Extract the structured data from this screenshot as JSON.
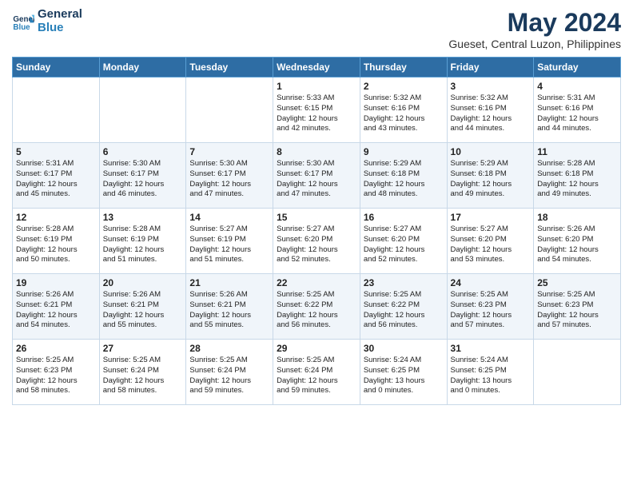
{
  "header": {
    "logo_line1": "General",
    "logo_line2": "Blue",
    "title": "May 2024",
    "subtitle": "Gueset, Central Luzon, Philippines"
  },
  "days_of_week": [
    "Sunday",
    "Monday",
    "Tuesday",
    "Wednesday",
    "Thursday",
    "Friday",
    "Saturday"
  ],
  "weeks": [
    [
      {
        "day": "",
        "info": ""
      },
      {
        "day": "",
        "info": ""
      },
      {
        "day": "",
        "info": ""
      },
      {
        "day": "1",
        "info": "Sunrise: 5:33 AM\nSunset: 6:15 PM\nDaylight: 12 hours\nand 42 minutes."
      },
      {
        "day": "2",
        "info": "Sunrise: 5:32 AM\nSunset: 6:16 PM\nDaylight: 12 hours\nand 43 minutes."
      },
      {
        "day": "3",
        "info": "Sunrise: 5:32 AM\nSunset: 6:16 PM\nDaylight: 12 hours\nand 44 minutes."
      },
      {
        "day": "4",
        "info": "Sunrise: 5:31 AM\nSunset: 6:16 PM\nDaylight: 12 hours\nand 44 minutes."
      }
    ],
    [
      {
        "day": "5",
        "info": "Sunrise: 5:31 AM\nSunset: 6:17 PM\nDaylight: 12 hours\nand 45 minutes."
      },
      {
        "day": "6",
        "info": "Sunrise: 5:30 AM\nSunset: 6:17 PM\nDaylight: 12 hours\nand 46 minutes."
      },
      {
        "day": "7",
        "info": "Sunrise: 5:30 AM\nSunset: 6:17 PM\nDaylight: 12 hours\nand 47 minutes."
      },
      {
        "day": "8",
        "info": "Sunrise: 5:30 AM\nSunset: 6:17 PM\nDaylight: 12 hours\nand 47 minutes."
      },
      {
        "day": "9",
        "info": "Sunrise: 5:29 AM\nSunset: 6:18 PM\nDaylight: 12 hours\nand 48 minutes."
      },
      {
        "day": "10",
        "info": "Sunrise: 5:29 AM\nSunset: 6:18 PM\nDaylight: 12 hours\nand 49 minutes."
      },
      {
        "day": "11",
        "info": "Sunrise: 5:28 AM\nSunset: 6:18 PM\nDaylight: 12 hours\nand 49 minutes."
      }
    ],
    [
      {
        "day": "12",
        "info": "Sunrise: 5:28 AM\nSunset: 6:19 PM\nDaylight: 12 hours\nand 50 minutes."
      },
      {
        "day": "13",
        "info": "Sunrise: 5:28 AM\nSunset: 6:19 PM\nDaylight: 12 hours\nand 51 minutes."
      },
      {
        "day": "14",
        "info": "Sunrise: 5:27 AM\nSunset: 6:19 PM\nDaylight: 12 hours\nand 51 minutes."
      },
      {
        "day": "15",
        "info": "Sunrise: 5:27 AM\nSunset: 6:20 PM\nDaylight: 12 hours\nand 52 minutes."
      },
      {
        "day": "16",
        "info": "Sunrise: 5:27 AM\nSunset: 6:20 PM\nDaylight: 12 hours\nand 52 minutes."
      },
      {
        "day": "17",
        "info": "Sunrise: 5:27 AM\nSunset: 6:20 PM\nDaylight: 12 hours\nand 53 minutes."
      },
      {
        "day": "18",
        "info": "Sunrise: 5:26 AM\nSunset: 6:20 PM\nDaylight: 12 hours\nand 54 minutes."
      }
    ],
    [
      {
        "day": "19",
        "info": "Sunrise: 5:26 AM\nSunset: 6:21 PM\nDaylight: 12 hours\nand 54 minutes."
      },
      {
        "day": "20",
        "info": "Sunrise: 5:26 AM\nSunset: 6:21 PM\nDaylight: 12 hours\nand 55 minutes."
      },
      {
        "day": "21",
        "info": "Sunrise: 5:26 AM\nSunset: 6:21 PM\nDaylight: 12 hours\nand 55 minutes."
      },
      {
        "day": "22",
        "info": "Sunrise: 5:25 AM\nSunset: 6:22 PM\nDaylight: 12 hours\nand 56 minutes."
      },
      {
        "day": "23",
        "info": "Sunrise: 5:25 AM\nSunset: 6:22 PM\nDaylight: 12 hours\nand 56 minutes."
      },
      {
        "day": "24",
        "info": "Sunrise: 5:25 AM\nSunset: 6:23 PM\nDaylight: 12 hours\nand 57 minutes."
      },
      {
        "day": "25",
        "info": "Sunrise: 5:25 AM\nSunset: 6:23 PM\nDaylight: 12 hours\nand 57 minutes."
      }
    ],
    [
      {
        "day": "26",
        "info": "Sunrise: 5:25 AM\nSunset: 6:23 PM\nDaylight: 12 hours\nand 58 minutes."
      },
      {
        "day": "27",
        "info": "Sunrise: 5:25 AM\nSunset: 6:24 PM\nDaylight: 12 hours\nand 58 minutes."
      },
      {
        "day": "28",
        "info": "Sunrise: 5:25 AM\nSunset: 6:24 PM\nDaylight: 12 hours\nand 59 minutes."
      },
      {
        "day": "29",
        "info": "Sunrise: 5:25 AM\nSunset: 6:24 PM\nDaylight: 12 hours\nand 59 minutes."
      },
      {
        "day": "30",
        "info": "Sunrise: 5:24 AM\nSunset: 6:25 PM\nDaylight: 13 hours\nand 0 minutes."
      },
      {
        "day": "31",
        "info": "Sunrise: 5:24 AM\nSunset: 6:25 PM\nDaylight: 13 hours\nand 0 minutes."
      },
      {
        "day": "",
        "info": ""
      }
    ]
  ]
}
